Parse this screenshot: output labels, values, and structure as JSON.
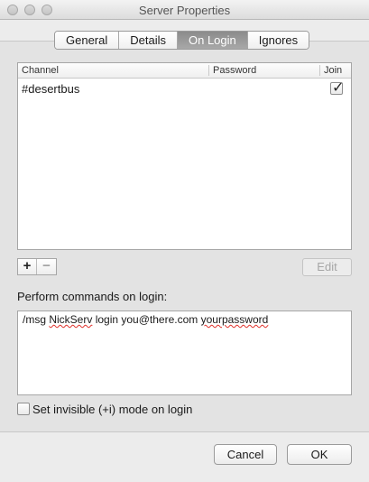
{
  "window": {
    "title": "Server Properties"
  },
  "tabs": [
    {
      "label": "General"
    },
    {
      "label": "Details"
    },
    {
      "label": "On Login",
      "selected": true
    },
    {
      "label": "Ignores"
    }
  ],
  "channels_table": {
    "headers": {
      "channel": "Channel",
      "password": "Password",
      "join": "Join"
    },
    "rows": [
      {
        "channel": "#desertbus",
        "password": "",
        "join": true
      }
    ]
  },
  "table_controls": {
    "add": "+",
    "remove": "−",
    "edit": "Edit"
  },
  "commands": {
    "label": "Perform commands on login:",
    "text_parts": [
      "/msg ",
      "NickServ",
      " login you@there.com ",
      "yourpassword"
    ]
  },
  "invisible_mode": {
    "label": "Set invisible (+i) mode on login",
    "checked": false
  },
  "footer": {
    "cancel": "Cancel",
    "ok": "OK"
  },
  "icons": {
    "join_check": "✓"
  }
}
